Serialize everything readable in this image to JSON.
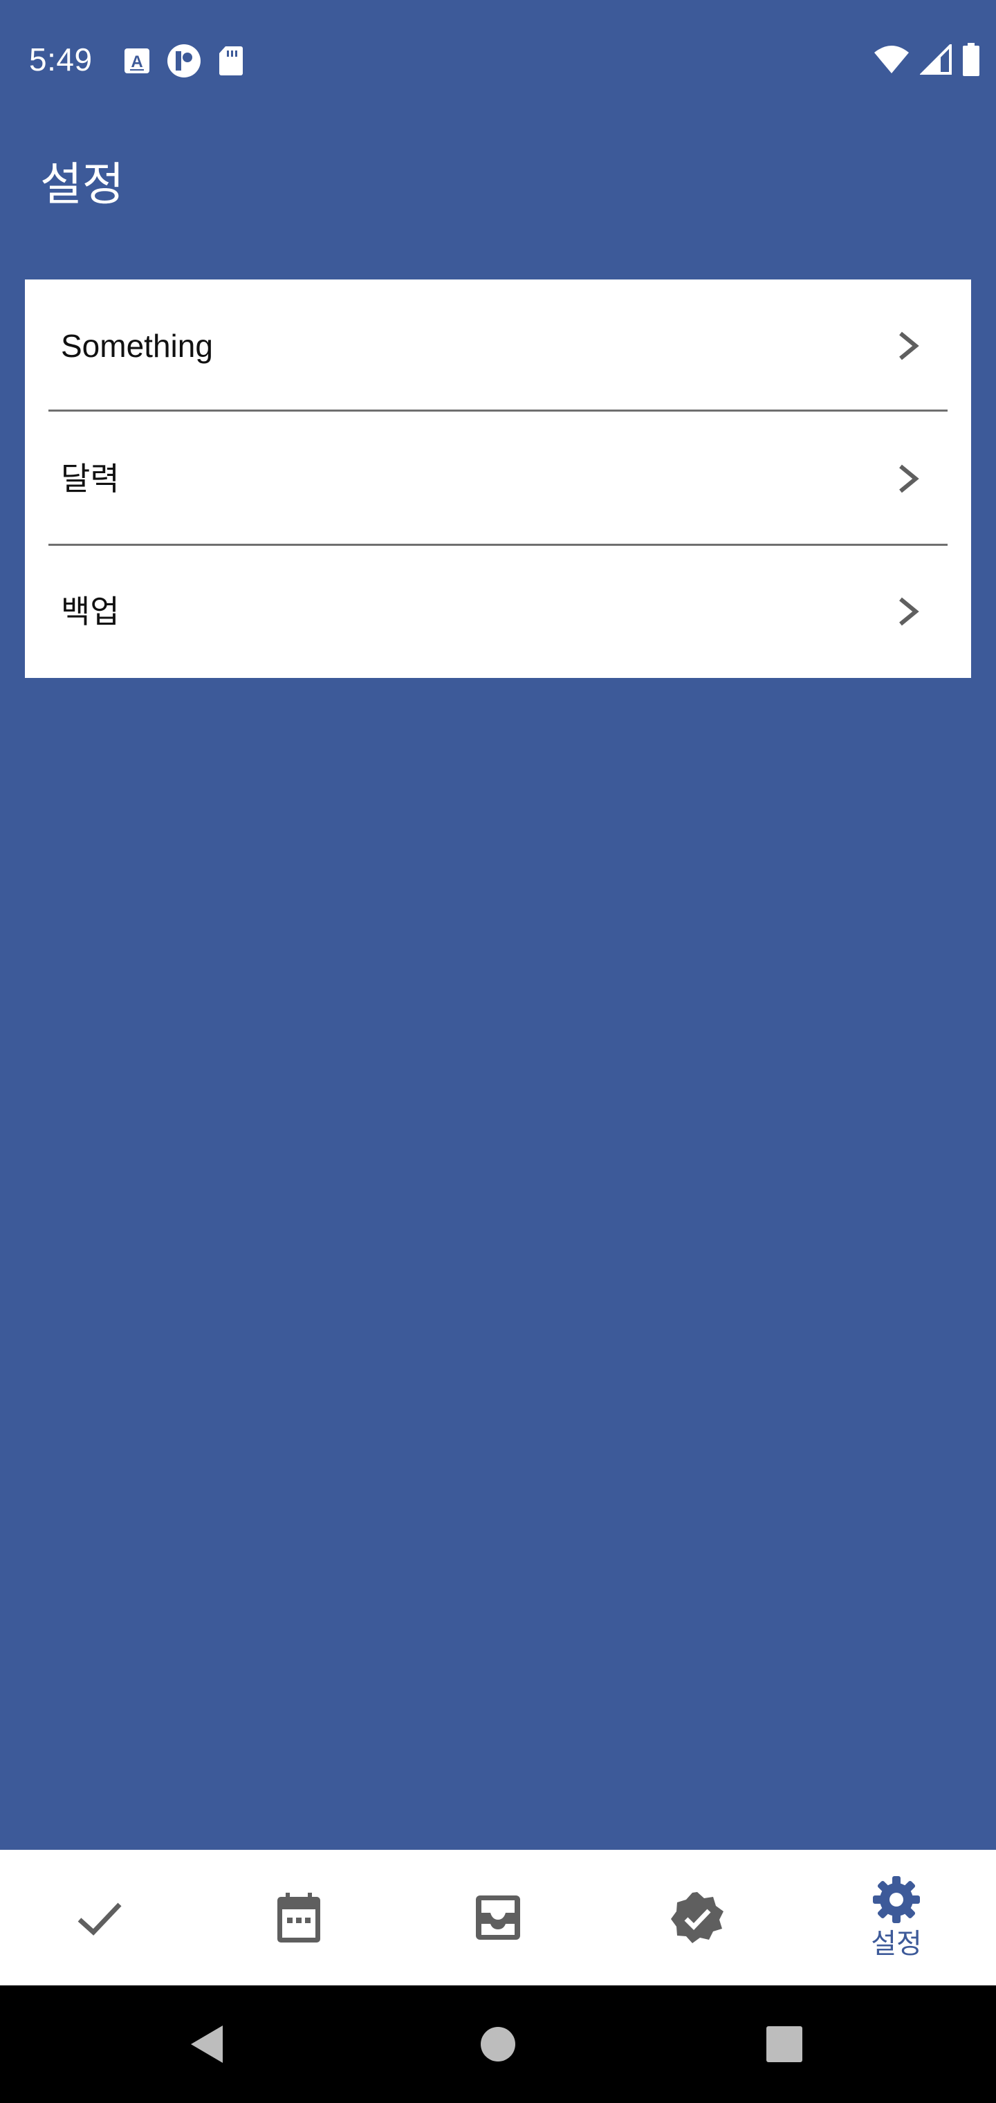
{
  "status_bar": {
    "time": "5:49",
    "left_icons": [
      "a-keyboard-icon",
      "circle-app-icon",
      "sd-card-icon"
    ],
    "right_icons": [
      "wifi-icon",
      "signal-icon",
      "battery-icon"
    ]
  },
  "app_bar": {
    "title": "설정"
  },
  "settings": {
    "items": [
      {
        "label": "Something",
        "icon": "chevron-right-icon"
      },
      {
        "label": "달력",
        "icon": "chevron-right-icon"
      },
      {
        "label": "백업",
        "icon": "chevron-right-icon"
      }
    ]
  },
  "bottom_nav": {
    "items": [
      {
        "icon": "check-icon",
        "label": ""
      },
      {
        "icon": "calendar-icon",
        "label": ""
      },
      {
        "icon": "inbox-icon",
        "label": ""
      },
      {
        "icon": "verified-badge-icon",
        "label": ""
      },
      {
        "icon": "gear-icon",
        "label": "설정",
        "selected": true
      }
    ]
  },
  "colors": {
    "primary": "#3d5a99",
    "card_background": "#ffffff",
    "icon_gray": "#5f5f5f",
    "system_nav_background": "#000000"
  }
}
